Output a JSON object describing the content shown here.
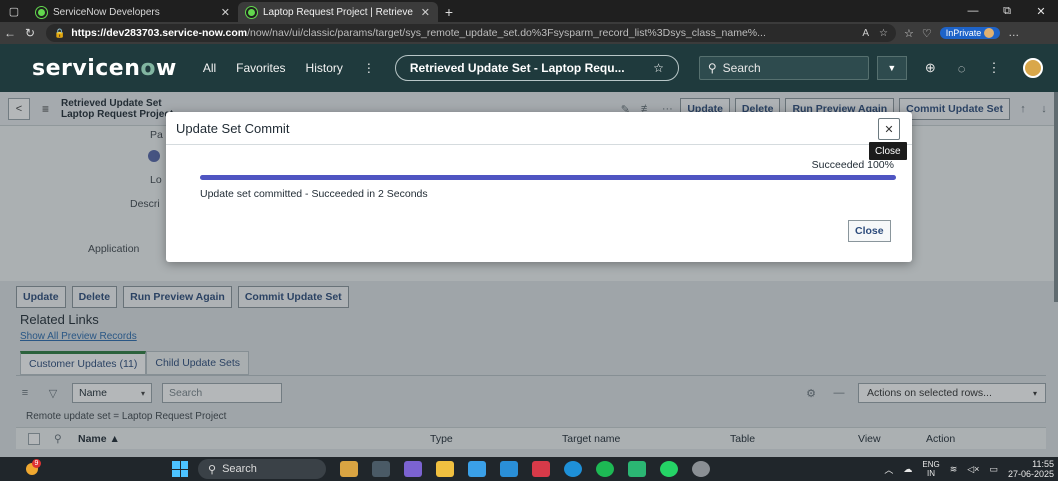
{
  "browser": {
    "tabs": [
      {
        "title": "ServiceNow Developers",
        "active": false
      },
      {
        "title": "Laptop Request Project | Retrieve",
        "active": true
      }
    ],
    "url_host": "https://dev283703.service-now.com",
    "url_path": "/now/nav/ui/classic/params/target/sys_remote_update_set.do%3Fsysparm_record_list%3Dsys_class_name%...",
    "inprivate": "InPrivate"
  },
  "header": {
    "logo_text": "servicenow",
    "menu": [
      "All",
      "Favorites",
      "History"
    ],
    "context_pill": "Retrieved Update Set - Laptop Requ...",
    "search_label": "Search"
  },
  "form": {
    "title_line1": "Retrieved Update Set",
    "title_line2": "Laptop Request Project",
    "toolbar_buttons": [
      "Update",
      "Delete",
      "Run Preview Again",
      "Commit Update Set"
    ],
    "labels": {
      "parent": "Pa",
      "local": "Lo",
      "description": "Descri",
      "application": "Application"
    },
    "action_buttons": [
      "Update",
      "Delete",
      "Run Preview Again",
      "Commit Update Set"
    ]
  },
  "related": {
    "heading": "Related Links",
    "show_all": "Show All Preview Records"
  },
  "related_tabs": [
    "Customer Updates (11)",
    "Child Update Sets"
  ],
  "list": {
    "field_select": "Name",
    "search_placeholder": "Search",
    "actions_select": "Actions on selected rows...",
    "breadcrumb": "Remote update set = Laptop Request Project",
    "columns": [
      "Name ▲",
      "Type",
      "Target name",
      "Table",
      "View",
      "Action"
    ]
  },
  "modal": {
    "title": "Update Set Commit",
    "status": "Succeeded 100%",
    "progress_percent": 100,
    "message": "Update set committed - Succeeded in 2 Seconds",
    "close_button": "Close",
    "close_tooltip": "Close"
  },
  "taskbar": {
    "search": "Search",
    "weather_badge": "9",
    "lang_line1": "ENG",
    "lang_line2": "IN",
    "time": "11:55",
    "date": "27-06-2025"
  },
  "colors": {
    "header_bg": "#1f3a3d",
    "progress": "#4f55c2",
    "tab_active_border": "#2e7d3f",
    "logo_accent": "#81b5a1"
  }
}
